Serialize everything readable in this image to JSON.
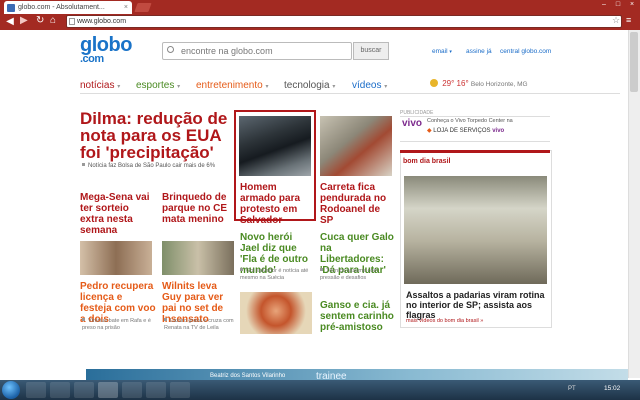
{
  "browser": {
    "tab_title": "globo.com - Absolutament...",
    "tab_close": "×",
    "address": "www.globo.com",
    "star": "☆",
    "wrench": "🔧",
    "back": "◀",
    "win_min": "–",
    "win_max": "□",
    "win_close": "×"
  },
  "header": {
    "logo_main": "globo",
    "logo_domain": ".com",
    "search_placeholder": "encontre na globo.com",
    "search_button": "buscar",
    "links": {
      "email": "email",
      "signup": "assine já",
      "central": "central globo.com"
    },
    "nav": [
      {
        "label": "notícias",
        "color": "#b0171a"
      },
      {
        "label": "esportes",
        "color": "#4a8a22"
      },
      {
        "label": "entretenimento",
        "color": "#e55b18"
      },
      {
        "label": "tecnologia",
        "color": "#555555"
      },
      {
        "label": "vídeos",
        "color": "#1a6cc8"
      }
    ],
    "weather": {
      "temps": "29° 16°",
      "city": "Belo Horizonte, MG"
    }
  },
  "news": {
    "main_headline": "Dilma: redução de nota para os EUA foi 'precipitação'",
    "main_sub": "Notícia faz Bolsa de São Paulo cair mais de 6%",
    "featured_headline": "Homem armado para protesto em Salvador",
    "col1": [
      {
        "headline": "Mega-Sena vai ter sorteio extra nesta semana"
      },
      {
        "headline": "Pedro recupera licença e festeja com voo a dois",
        "sub": "Vinícius bate em Rafa e é preso na prisão"
      }
    ],
    "col2": [
      {
        "headline": "Brinquedo de parque no CE mata menino"
      },
      {
        "headline": "Wilnits leva Guy para ver pai no set de Insensato",
        "sub": "Lázaro grava e cruza com Renata na TV de Leila"
      }
    ],
    "col3": [
      {
        "headline": "Carreta fica pendurada no Rodoanel de SP"
      },
      {
        "headline": "Cuca quer Galo na Libertadores: 'Dá para lutar'",
        "sub": "Técnico assume com pressão e desafios"
      },
      {
        "headline": "Ganso e cia. já sentem carinho pré-amistoso"
      }
    ],
    "sport1": {
      "headline": "Novo herói Jael diz que 'Fla é de outro mundo'",
      "sub": "Gol salvador é notícia até mesmo na Suécia"
    }
  },
  "sidebar": {
    "pub_label": "PUBLICIDADE",
    "ad_brand": "vivo",
    "ad_text": "Conheça o Vivo Torpedo Center na",
    "ad_text2": "LOJA DE SERVIÇOS",
    "ad_brand2": "vivo",
    "section": "bom dia brasil",
    "headline": "Assaltos a padarias viram rotina no interior de SP; assista aos flagras",
    "more": "mais vídeos do bom dia brasil »"
  },
  "bottom": {
    "ad_text": "Beatriz dos Santos Vilarinho",
    "ad_brand": "trainee",
    "clock": "15:02",
    "tray": "PT"
  }
}
